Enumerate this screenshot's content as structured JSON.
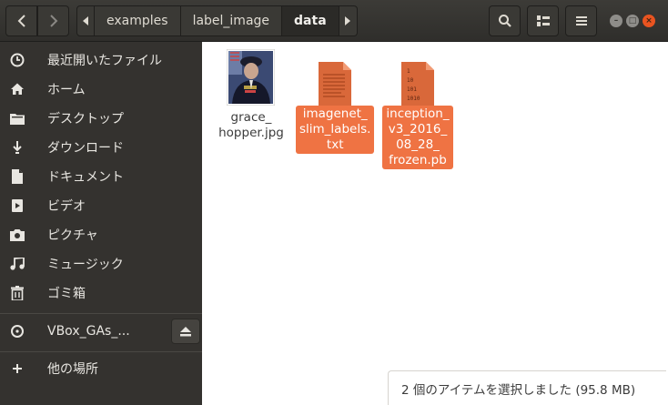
{
  "header": {
    "path": [
      "examples",
      "label_image",
      "data"
    ]
  },
  "sidebar": {
    "items": [
      {
        "icon": "recent-icon",
        "label": "最近開いたファイル"
      },
      {
        "icon": "home-icon",
        "label": "ホーム"
      },
      {
        "icon": "folder-icon",
        "label": "デスクトップ"
      },
      {
        "icon": "download-icon",
        "label": "ダウンロード"
      },
      {
        "icon": "document-icon",
        "label": "ドキュメント"
      },
      {
        "icon": "video-icon",
        "label": "ビデオ"
      },
      {
        "icon": "camera-icon",
        "label": "ピクチャ"
      },
      {
        "icon": "music-icon",
        "label": "ミュージック"
      },
      {
        "icon": "trash-icon",
        "label": "ゴミ箱"
      }
    ],
    "device": {
      "icon": "disc-icon",
      "label": "VBox_GAs_..."
    },
    "other": {
      "icon": "plus-icon",
      "label": "他の場所"
    }
  },
  "files": [
    {
      "name": "grace_\nhopper.jpg",
      "selected": false,
      "type": "image"
    },
    {
      "name": "imagenet_\nslim_labels.\ntxt",
      "selected": true,
      "type": "text"
    },
    {
      "name": "inception_\nv3_2016_\n08_28_\nfrozen.pb",
      "selected": true,
      "type": "binary"
    }
  ],
  "binary_icon_text": [
    "1",
    "10",
    "101",
    "1010"
  ],
  "status": "2 個のアイテムを選択しました (95.8 MB)",
  "colors": {
    "accent": "#ef7343",
    "sidebar": "#34322f",
    "header": "#3c3b37",
    "file_icon": "#d9683a"
  }
}
